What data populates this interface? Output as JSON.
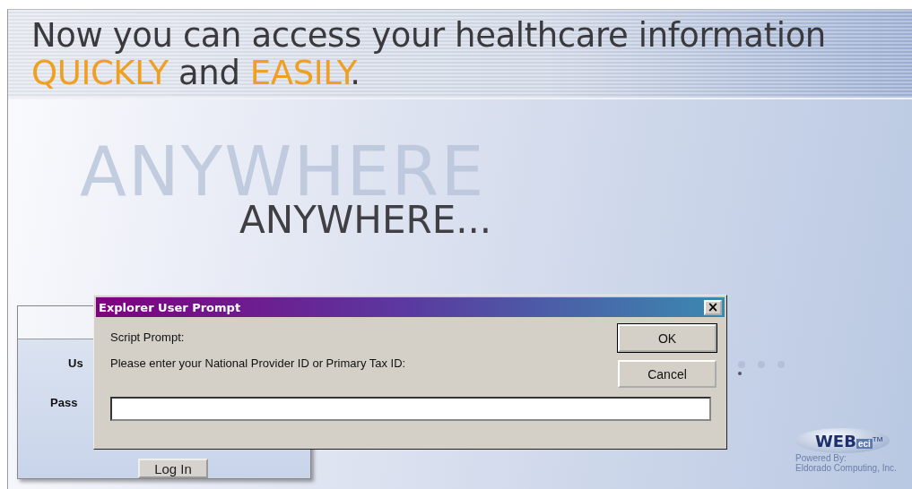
{
  "banner": {
    "line_1": "Now you can access your healthcare information",
    "line_2": [
      {
        "text": "QUICKLY",
        "highlight": true
      },
      {
        "text": " and ",
        "highlight": false
      },
      {
        "text": "EASILY",
        "highlight": true
      },
      {
        "text": ".",
        "highlight": false
      }
    ]
  },
  "hero": {
    "ghost_word": "ANYWHERE",
    "word": "ANYWHERE..."
  },
  "login": {
    "labels": [
      "Us",
      "Pass"
    ],
    "button": "Log In"
  },
  "dialog": {
    "title": "Explorer User Prompt",
    "close": "×",
    "caption": "Script Prompt:",
    "message": "Please enter your National Provider ID or Primary Tax ID:",
    "buttons": [
      {
        "label": "OK",
        "default": true
      },
      {
        "label": "Cancel",
        "default": false
      }
    ]
  },
  "footer": {
    "logo_main": "WEB",
    "logo_sub": "eci",
    "trademark": "TM",
    "powered_by": "Powered By:",
    "company": "Eldorado Computing, Inc."
  }
}
